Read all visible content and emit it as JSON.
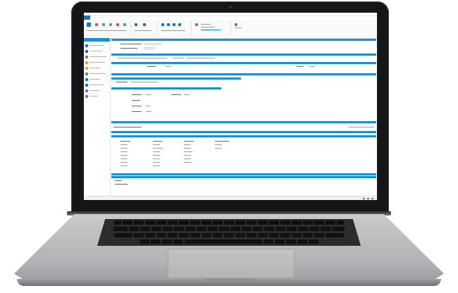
{
  "app": {
    "accent_color": "#1a8fd1",
    "sidebar_items": [
      {
        "icon": "document-icon",
        "color": "#1a6fbf"
      },
      {
        "icon": "user-icon",
        "color": "#555555"
      },
      {
        "icon": "list-icon",
        "color": "#7a7a7a"
      },
      {
        "icon": "warning-icon",
        "color": "#f0a020"
      },
      {
        "icon": "folder-icon",
        "color": "#f0a020"
      },
      {
        "icon": "settings-icon",
        "color": "#7a7a7a"
      },
      {
        "icon": "chart-icon",
        "color": "#1a6fbf"
      },
      {
        "icon": "report-icon",
        "color": "#1a6fbf"
      },
      {
        "icon": "calendar-icon",
        "color": "#7a7a7a"
      },
      {
        "icon": "help-icon",
        "color": "#7a7a7a"
      }
    ]
  }
}
